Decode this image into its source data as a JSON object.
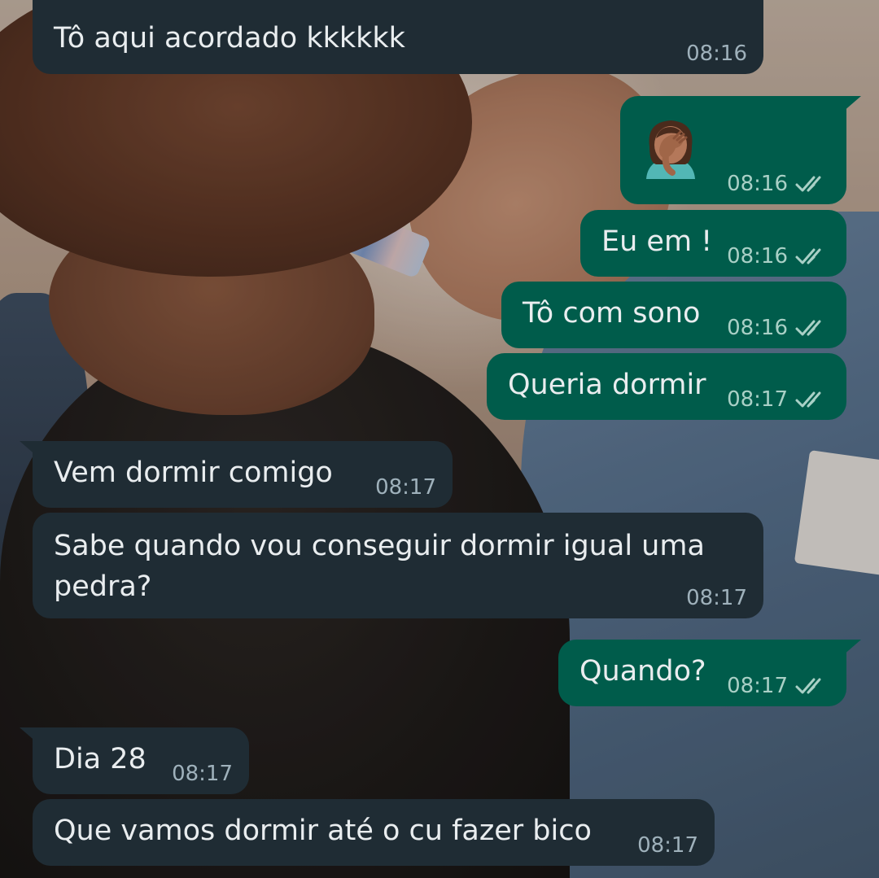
{
  "messages": [
    {
      "id": "m1",
      "direction": "incoming",
      "text": "Tô aqui acordado kkkkkk",
      "time": "08:16"
    },
    {
      "id": "m2",
      "direction": "outgoing",
      "emoji": "woman-facepalming-emoji",
      "time": "08:16",
      "status": "read"
    },
    {
      "id": "m3",
      "direction": "outgoing",
      "text": "Eu em !",
      "time": "08:16",
      "status": "read"
    },
    {
      "id": "m4",
      "direction": "outgoing",
      "text": "Tô com sono",
      "time": "08:16",
      "status": "read"
    },
    {
      "id": "m5",
      "direction": "outgoing",
      "text": "Queria dormir",
      "time": "08:17",
      "status": "read"
    },
    {
      "id": "m6",
      "direction": "incoming",
      "text": "Vem dormir comigo",
      "time": "08:17"
    },
    {
      "id": "m7",
      "direction": "incoming",
      "text": "Sabe quando vou conseguir dormir igual uma pedra?",
      "time": "08:17"
    },
    {
      "id": "m8",
      "direction": "outgoing",
      "text": "Quando?",
      "time": "08:17",
      "status": "read"
    },
    {
      "id": "m9",
      "direction": "incoming",
      "text": "Dia 28",
      "time": "08:17"
    },
    {
      "id": "m10",
      "direction": "incoming",
      "text": "Que vamos dormir até o cu fazer bico",
      "time": "08:17"
    }
  ],
  "theme": {
    "incoming_bubble": "#1f2c34",
    "outgoing_bubble": "#005c4b",
    "text": "#e9edef",
    "timestamp": "#9fb1bb",
    "read_ticks": "#a9d0c6"
  },
  "icons": {
    "status_read": "double-check-icon"
  }
}
